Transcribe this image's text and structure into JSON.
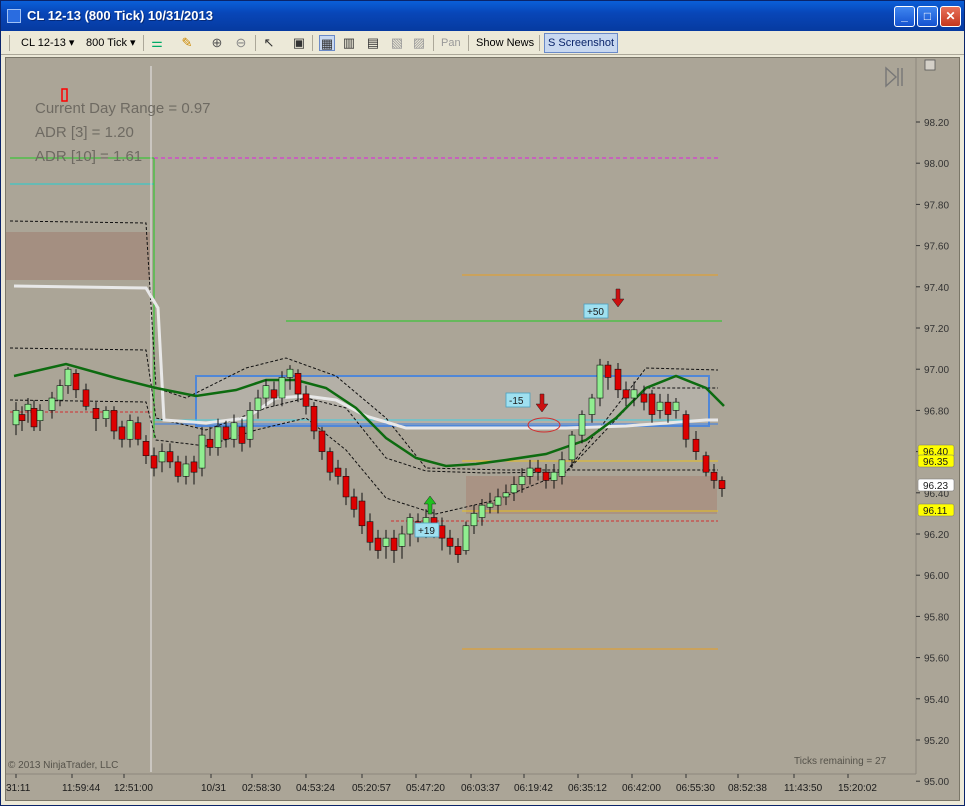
{
  "window": {
    "title": "CL 12-13 (800 Tick)  10/31/2013",
    "buttons": {
      "minimize": "_",
      "maximize": "□",
      "close": "✕"
    }
  },
  "toolbar": {
    "instrument": "CL 12-13",
    "interval": "800 Tick",
    "pan_label": "Pan",
    "show_news_label": "Show News",
    "screenshot_label": "S Screenshot"
  },
  "chart": {
    "overlay_lines": [
      "Current Day Range = 0.97",
      "ADR [3] = 1.20",
      "ADR [10] = 1.61"
    ],
    "copyright": "© 2013 NinjaTrader, LLC",
    "ticks_remaining": "Ticks remaining = 27",
    "price_ticks": [
      "98.20",
      "98.00",
      "97.80",
      "97.60",
      "97.40",
      "97.20",
      "97.00",
      "96.80",
      "96.60",
      "96.40",
      "96.20",
      "96.00",
      "95.80",
      "95.60",
      "95.40",
      "95.20",
      "95.00"
    ],
    "price_markers": [
      {
        "label": "96.40",
        "color": "#ffff00"
      },
      {
        "label": "96.35",
        "color": "#ffff00"
      },
      {
        "label": "96.23",
        "color": "#ffffff"
      },
      {
        "label": "96.11",
        "color": "#ffff00"
      }
    ],
    "time_ticks": [
      "31:11",
      "11:59:44",
      "12:51:00",
      "10/31",
      "02:58:30",
      "04:53:24",
      "05:20:57",
      "05:47:20",
      "06:03:37",
      "06:19:42",
      "06:35:12",
      "06:42:00",
      "06:55:30",
      "08:52:38",
      "11:43:50",
      "15:20:02"
    ],
    "annotations": [
      "+50",
      "-15",
      "+19"
    ],
    "colors": {
      "background": "#aba597",
      "ema": "#0d6b10",
      "vwap": "#e6e6e6",
      "up_candle": "#90ee90",
      "down_candle": "#dd0000"
    }
  }
}
